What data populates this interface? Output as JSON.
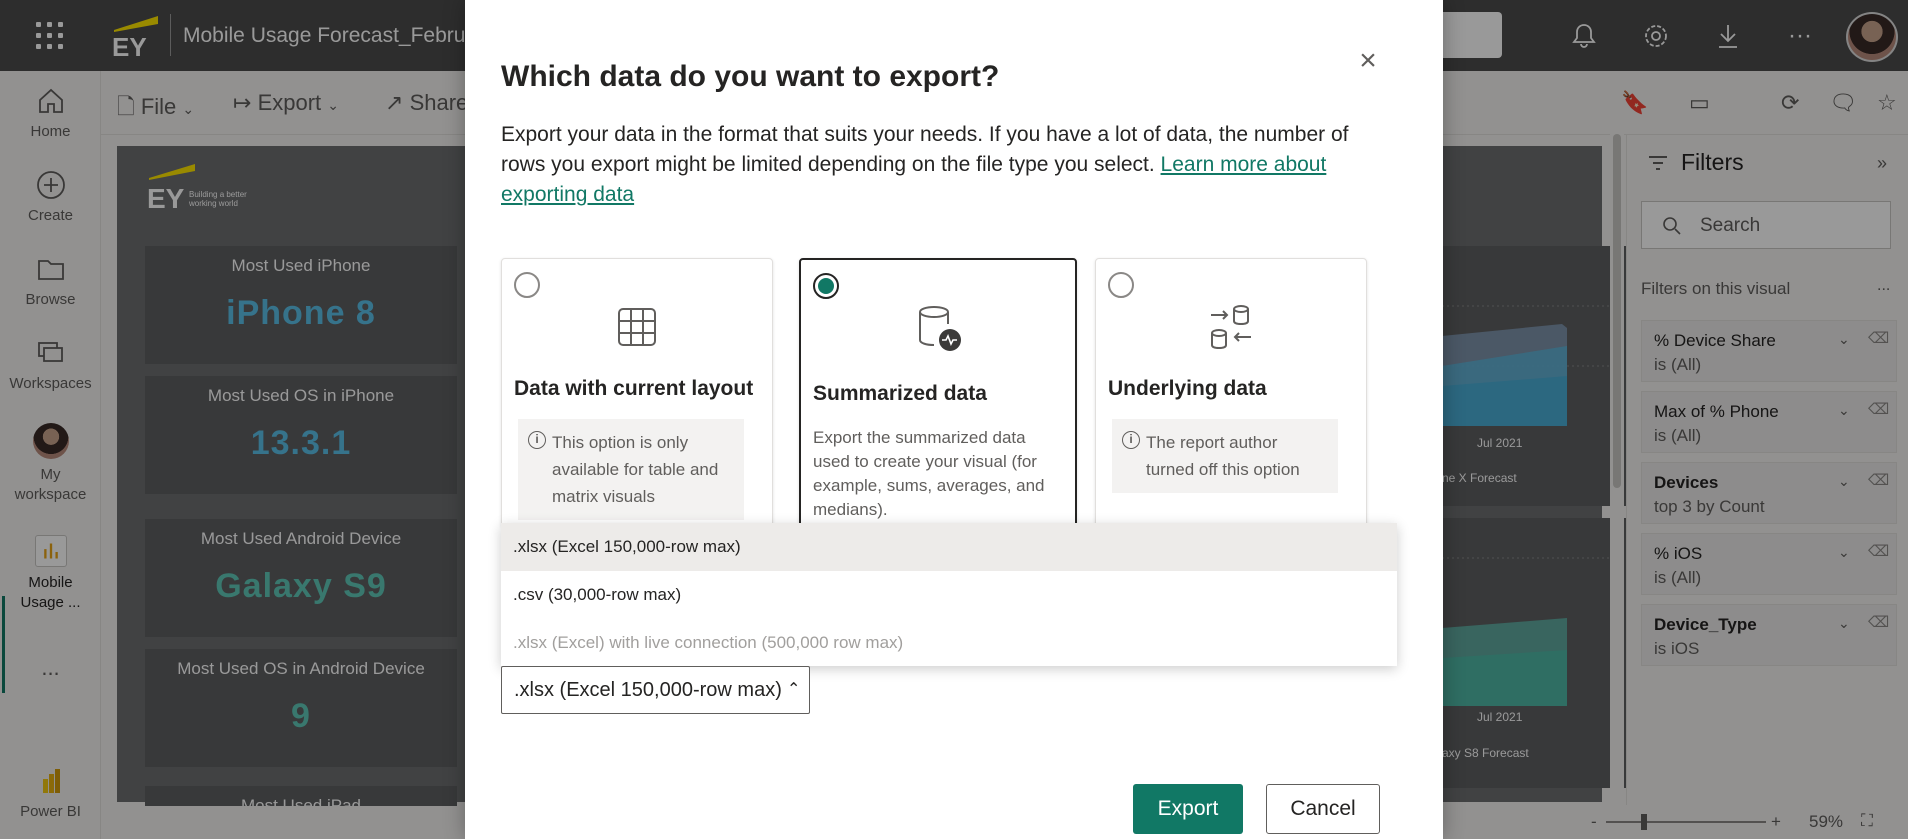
{
  "topbar": {
    "report_title": "Mobile Usage Forecast_Februa",
    "icons": [
      "app-launcher-icon",
      "notifications-icon",
      "settings-icon",
      "download-icon",
      "more-icon"
    ]
  },
  "leftnav": {
    "items": [
      {
        "label": "Home",
        "icon": "home-icon"
      },
      {
        "label": "Create",
        "icon": "create-icon"
      },
      {
        "label": "Browse",
        "icon": "folder-icon"
      },
      {
        "label": "Workspaces",
        "icon": "workspaces-icon"
      },
      {
        "label": "My workspace",
        "icon": "avatar"
      },
      {
        "label": "Mobile Usage ...",
        "icon": "report-icon"
      }
    ],
    "more": "...",
    "powerbi": "Power BI"
  },
  "toolbar": {
    "file": "File",
    "export": "Export",
    "share": "Share"
  },
  "canvas": {
    "logo_tagline": "Building a better working world",
    "cards": [
      {
        "title": "Most Used iPhone",
        "value": "iPhone 8",
        "color": "#5bc0e8"
      },
      {
        "title": "Most Used OS in iPhone",
        "value": "13.3.1",
        "color": "#5bc0e8"
      },
      {
        "title": "Most Used Android Device",
        "value": "Galaxy S9",
        "color": "#5fc8b8"
      },
      {
        "title": "Most Used OS in Android Device",
        "value": "9",
        "color": "#5fc8b8"
      },
      {
        "title": "Most Used iPad",
        "value": ""
      }
    ],
    "chart1_tick": "Jul 2021",
    "chart1_label": "ne X Forecast",
    "chart2_tick": "Jul 2021",
    "chart2_label": "axy S8 Forecast"
  },
  "filters": {
    "title": "Filters",
    "search_placeholder": "Search",
    "section": "Filters on this visual",
    "more": "...",
    "items": [
      {
        "name": "% Device Share",
        "state": "is (All)",
        "bold": false
      },
      {
        "name": "Max of % Phone",
        "state": "is (All)",
        "bold": false
      },
      {
        "name": "Devices",
        "state": "top 3 by Count",
        "bold": true
      },
      {
        "name": "% iOS",
        "state": "is (All)",
        "bold": false
      },
      {
        "name": "Device_Type",
        "state": "is iOS",
        "bold": true
      }
    ]
  },
  "statusbar": {
    "zoom": "59%"
  },
  "dialog": {
    "title": "Which data do you want to export?",
    "description": "Export your data in the format that suits your needs. If you have a lot of data, the number of rows you export might be limited depending on the file type you select. ",
    "learn_more": "Learn more about exporting data",
    "options": [
      {
        "name": "Data with current layout",
        "info": "This option is only available for table and matrix visuals",
        "icon": "table-icon",
        "selected": false
      },
      {
        "name": "Summarized data",
        "desc": "Export the summarized data used to create your visual (for example, sums, averages, and medians).",
        "icon": "summarized-data-icon",
        "selected": true
      },
      {
        "name": "Underlying data",
        "info": "The report author turned off this option",
        "icon": "underlying-data-icon",
        "selected": false
      }
    ],
    "format_options": [
      ".xlsx (Excel 150,000-row max)",
      ".csv (30,000-row max)",
      ".xlsx (Excel) with live connection (500,000 row max)"
    ],
    "selected_format": ".xlsx (Excel 150,000-row max)",
    "export_label": "Export",
    "cancel_label": "Cancel",
    "accent": "#117865"
  }
}
